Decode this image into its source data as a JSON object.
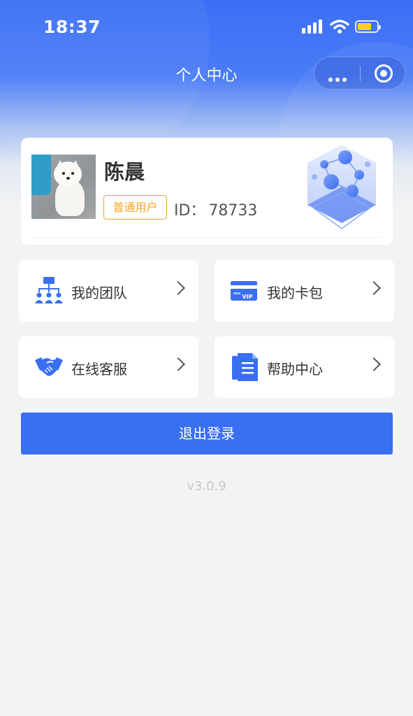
{
  "status_bar": {
    "time": "18:37"
  },
  "nav": {
    "title": "个人中心"
  },
  "profile": {
    "name": "陈晨",
    "badge": "普通用户",
    "id_label": "ID：",
    "id_value": "78733"
  },
  "menu": [
    {
      "label": "我的团队",
      "icon": "team-org-icon"
    },
    {
      "label": "我的卡包",
      "icon": "vip-card-icon"
    },
    {
      "label": "在线客服",
      "icon": "handshake-icon"
    },
    {
      "label": "帮助中心",
      "icon": "document-icon"
    }
  ],
  "logout": {
    "label": "退出登录"
  },
  "version": "v3.0.9",
  "colors": {
    "primary": "#3a6ff2",
    "badge": "#f5a623",
    "battery": "#ffd21f",
    "background": "#f2f3f3"
  }
}
